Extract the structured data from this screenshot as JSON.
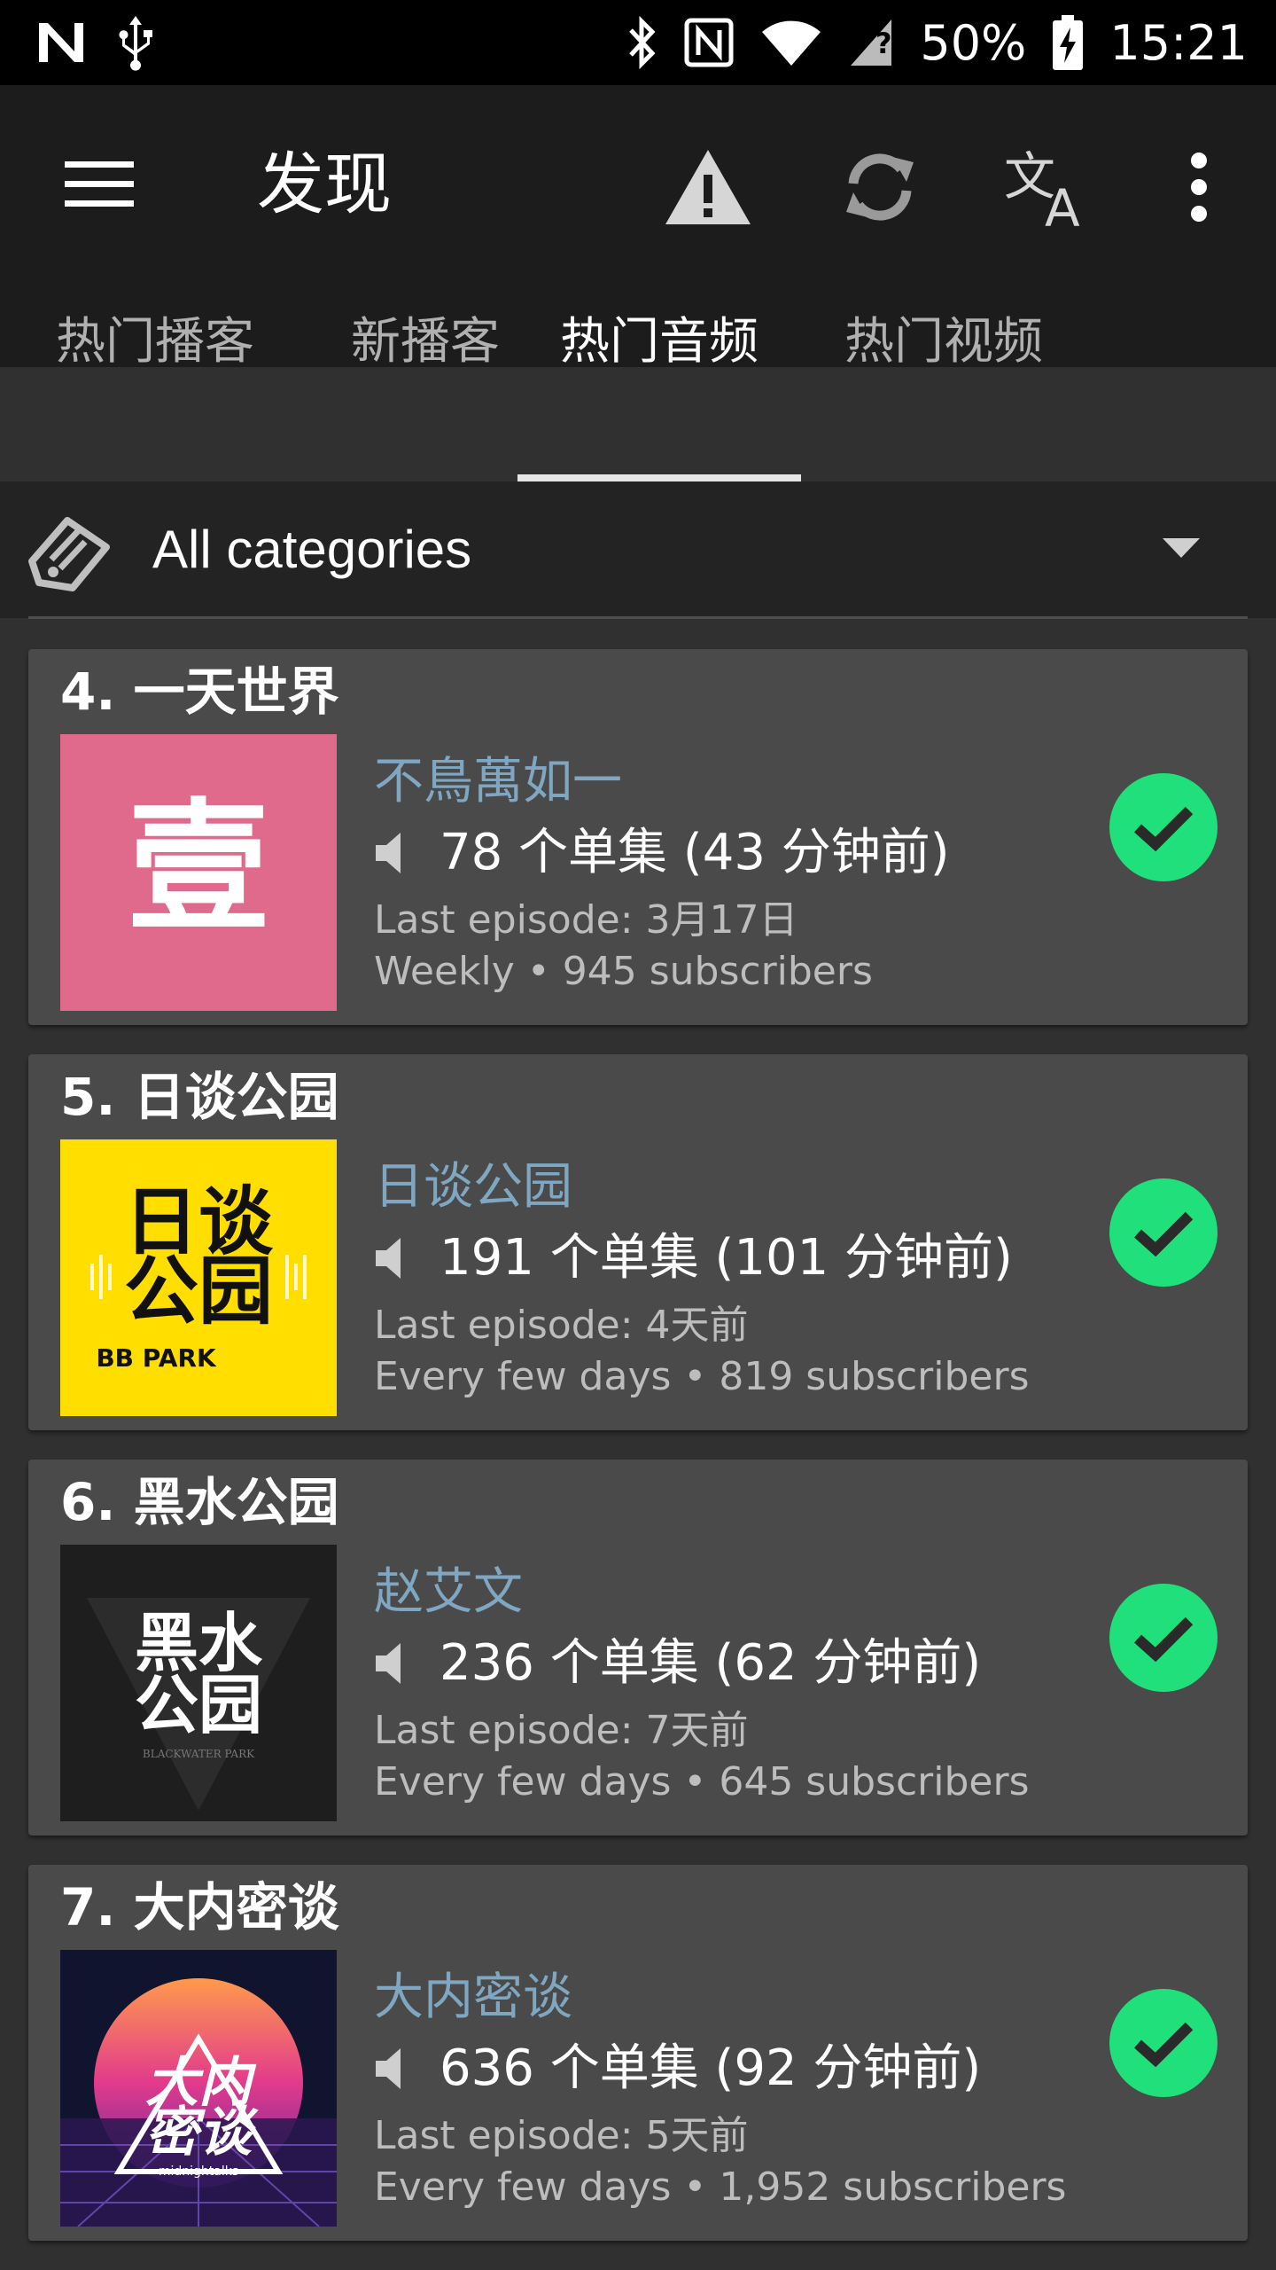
{
  "status_bar": {
    "battery": "50%",
    "time": "15:21"
  },
  "toolbar": {
    "title": "发现",
    "icons": [
      "menu-icon",
      "warning-icon",
      "refresh-icon",
      "translate-icon",
      "more-vert-icon"
    ]
  },
  "tabs": [
    {
      "label": "热门播客",
      "active": false
    },
    {
      "label": "新播客",
      "active": false
    },
    {
      "label": "热门音频",
      "active": true
    },
    {
      "label": "热门视频",
      "active": false
    }
  ],
  "category": {
    "label": "All categories"
  },
  "podcasts": [
    {
      "title": "4. 一天世界",
      "author": "不鳥萬如一",
      "episodes": "78 个单集 (43 分钟前)",
      "last_episode": "Last episode: 3月17日",
      "frequency": "Weekly • 945 subscribers",
      "art_text": "壹"
    },
    {
      "title": "5. 日谈公园",
      "author": "日谈公园",
      "episodes": "191 个单集 (101 分钟前)",
      "last_episode": "Last episode: 4天前",
      "frequency": "Every few days • 819 subscribers",
      "art_text_line1": "日谈",
      "art_text_line2": "公园",
      "art_text_line3": "BB PARK"
    },
    {
      "title": "6. 黑水公园",
      "author": "赵艾文",
      "episodes": "236 个单集 (62 分钟前)",
      "last_episode": "Last episode: 7天前",
      "frequency": "Every few days • 645 subscribers",
      "art_text_line1": "黑水",
      "art_text_line2": "公园",
      "art_text_line3": "BLACKWATER PARK"
    },
    {
      "title": "7. 大内密谈",
      "author": "大内密谈",
      "episodes": "636 个单集 (92 分钟前)",
      "last_episode": "Last episode: 5天前",
      "frequency": "Every few days • 1,952 subscribers",
      "art_text_line1": "大内",
      "art_text_line2": "密谈",
      "art_text_line3": "midnightalks"
    }
  ],
  "colors": {
    "background": "#303030",
    "toolbar": "#1c1c1c",
    "card": "#4a4a4a",
    "author": "#7fa7c2",
    "subscribed": "#1fe07a"
  }
}
